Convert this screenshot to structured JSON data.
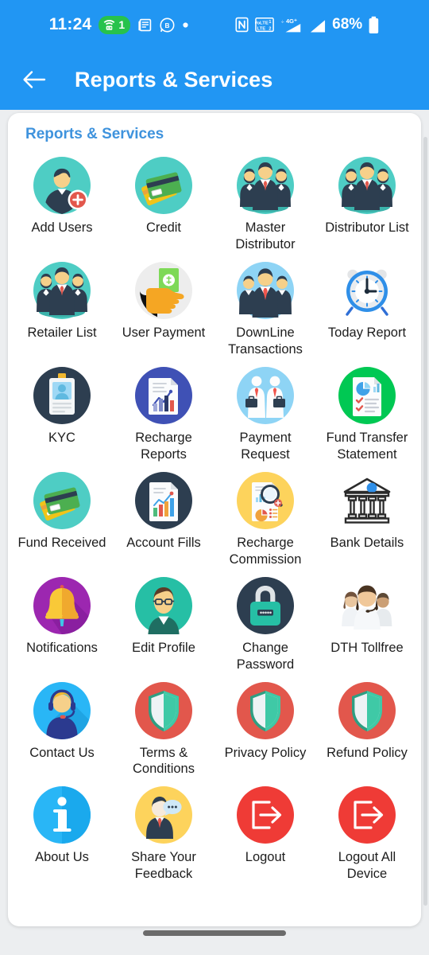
{
  "statusbar": {
    "time": "11:24",
    "wifi_badge_count": "1",
    "icons_left": [
      "wifi-hotspot-icon",
      "news-icon",
      "bluetooth-b-icon",
      "dot-icon"
    ],
    "icons_right": [
      "nfc-icon",
      "volte-icon",
      "signal-4g-plus-icon",
      "signal-bars-icon"
    ],
    "battery_percent": "68%",
    "background": "#2196f3"
  },
  "appbar": {
    "back_icon": "arrow-left-icon",
    "title": "Reports & Services",
    "background": "#2196f3"
  },
  "content": {
    "section_title": "Reports & Services",
    "accent_color": "#3f93dd",
    "tiles": [
      {
        "label": "Add Users",
        "icon": "add-user-icon",
        "bg": "#4ecdc4"
      },
      {
        "label": "Credit",
        "icon": "credit-card-icon",
        "bg": "#4ecdc4"
      },
      {
        "label": "Master Distributor",
        "icon": "group-men-icon",
        "bg": "#4ecdc4"
      },
      {
        "label": "Distributor List",
        "icon": "group-men-icon",
        "bg": "#4ecdc4"
      },
      {
        "label": "Retailer List",
        "icon": "group-men-icon",
        "bg": "#4ecdc4"
      },
      {
        "label": "User Payment",
        "icon": "hand-cash-icon",
        "bg": "#eeeeee"
      },
      {
        "label": "DownLine Transactions",
        "icon": "team-blue-icon",
        "bg": "#8ed4f5"
      },
      {
        "label": "Today Report",
        "icon": "alarm-clock-icon",
        "bg": "none"
      },
      {
        "label": "KYC",
        "icon": "id-card-icon",
        "bg": "#2d3e50"
      },
      {
        "label": "Recharge Reports",
        "icon": "report-chart-icon",
        "bg": "#3f51b5"
      },
      {
        "label": "Payment Request",
        "icon": "businessmen-briefcase-icon",
        "bg": "#8ed4f5"
      },
      {
        "label": "Fund Transfer Statement",
        "icon": "statement-doc-icon",
        "bg": "#00c853"
      },
      {
        "label": "Fund Received",
        "icon": "credit-card-icon",
        "bg": "#4ecdc4"
      },
      {
        "label": "Account Fills",
        "icon": "bar-chart-doc-icon",
        "bg": "#2d3e50"
      },
      {
        "label": "Recharge Commission",
        "icon": "analysis-search-icon",
        "bg": "#fdd35c"
      },
      {
        "label": "Bank Details",
        "icon": "bank-building-icon",
        "bg": "none"
      },
      {
        "label": "Notifications",
        "icon": "bell-icon",
        "bg": "#9c27b0"
      },
      {
        "label": "Edit Profile",
        "icon": "user-glasses-icon",
        "bg": "#26bfa5"
      },
      {
        "label": "Change Password",
        "icon": "padlock-icon",
        "bg": "#2d3e50"
      },
      {
        "label": "DTH Tollfree",
        "icon": "support-agents-icon",
        "bg": "none"
      },
      {
        "label": "Contact Us",
        "icon": "headset-operator-icon",
        "bg": "#29b6f6"
      },
      {
        "label": "Terms & Conditions",
        "icon": "shield-icon",
        "bg": "#e2574c"
      },
      {
        "label": "Privacy Policy",
        "icon": "shield-icon",
        "bg": "#e2574c"
      },
      {
        "label": "Refund Policy",
        "icon": "shield-icon",
        "bg": "#e2574c"
      },
      {
        "label": "About Us",
        "icon": "info-icon",
        "bg": "#29b6f6"
      },
      {
        "label": "Share Your Feedback",
        "icon": "feedback-person-icon",
        "bg": "#fdd35c"
      },
      {
        "label": "Logout",
        "icon": "logout-arrow-icon",
        "bg": "#ef3b36"
      },
      {
        "label": "Logout All Device",
        "icon": "logout-arrow-icon",
        "bg": "#ef3b36"
      }
    ]
  },
  "navigation": {
    "gesture_bar": "home-gesture-bar"
  }
}
